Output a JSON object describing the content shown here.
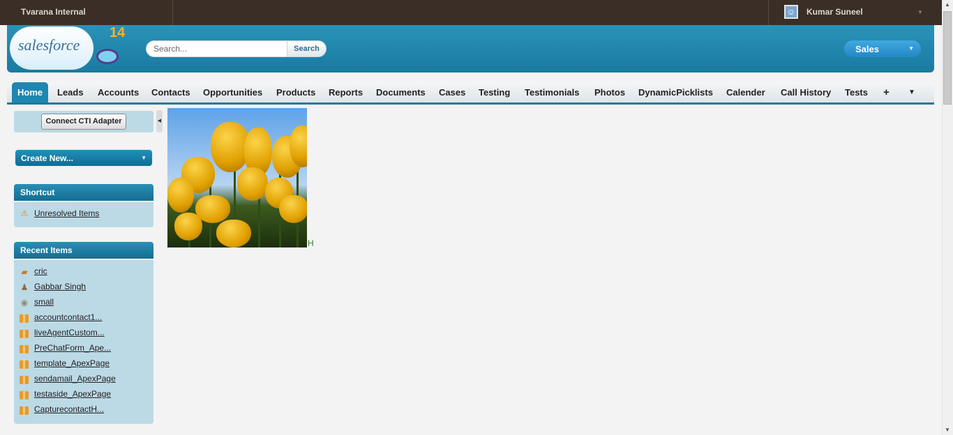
{
  "topbar": {
    "org_name": "Tvarana Internal",
    "user_name": "Kumar Suneel"
  },
  "header": {
    "logo_text": "salesforce",
    "logo_number": "14",
    "search_placeholder": "Search...",
    "search_button": "Search",
    "app_selector": "Sales"
  },
  "tabs": [
    {
      "label": "Home",
      "active": true
    },
    {
      "label": "Leads"
    },
    {
      "label": "Accounts"
    },
    {
      "label": "Contacts"
    },
    {
      "label": "Opportunities"
    },
    {
      "label": "Products"
    },
    {
      "label": "Reports"
    },
    {
      "label": "Documents"
    },
    {
      "label": "Cases"
    },
    {
      "label": "Testing"
    },
    {
      "label": "Testimonials"
    },
    {
      "label": "Photos"
    },
    {
      "label": "DynamicPicklists"
    },
    {
      "label": "Calender"
    },
    {
      "label": "Call History"
    },
    {
      "label": "Tests"
    }
  ],
  "sidebar": {
    "cti_button": "Connect CTI Adapter",
    "create_new": "Create New...",
    "shortcut": {
      "title": "Shortcut",
      "items": [
        {
          "label": "Unresolved Items",
          "icon": "warning-icon"
        }
      ]
    },
    "recent": {
      "title": "Recent Items",
      "items": [
        {
          "label": "cric",
          "icon": "account-icon"
        },
        {
          "label": "Gabbar Singh",
          "icon": "contact-icon"
        },
        {
          "label": "small",
          "icon": "opportunity-icon"
        },
        {
          "label": "accountcontact1...",
          "icon": "custom-object-icon"
        },
        {
          "label": "liveAgentCustom...",
          "icon": "custom-object-icon"
        },
        {
          "label": "PreChatForm_Ape...",
          "icon": "custom-object-icon"
        },
        {
          "label": "template_ApexPage",
          "icon": "custom-object-icon"
        },
        {
          "label": "sendamail_ApexPage",
          "icon": "custom-object-icon"
        },
        {
          "label": "testaside_ApexPage",
          "icon": "custom-object-icon"
        },
        {
          "label": "CapturecontactH...",
          "icon": "custom-object-icon"
        }
      ]
    }
  },
  "main": {
    "photo_caption": "H"
  },
  "colors": {
    "topbar": "#3a2e26",
    "header": "#1a7aa0",
    "sidebar_panel": "#bcd9e6",
    "active_tab": "#1f86b0"
  }
}
